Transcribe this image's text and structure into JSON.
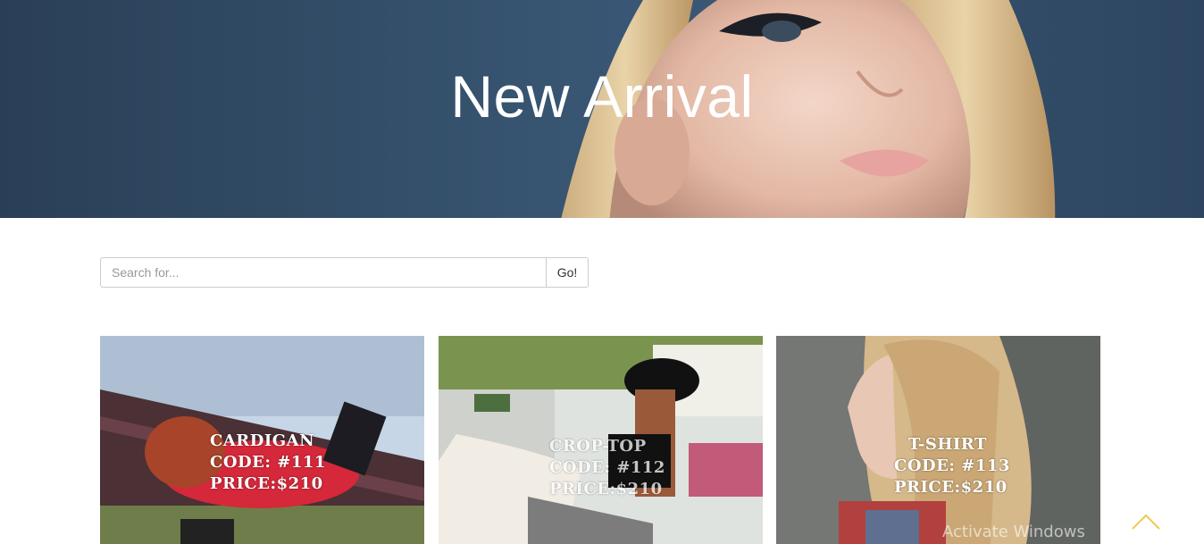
{
  "hero": {
    "title": "New Arrival"
  },
  "search": {
    "placeholder": "Search for...",
    "button_label": "Go!"
  },
  "products": [
    {
      "name": "CARDIGAN",
      "code": "CODE: #111",
      "price": "PRICE:$210"
    },
    {
      "name": "CROP-TOP",
      "code": "CODE: #112",
      "price": "PRICE:$210"
    },
    {
      "name": "T-SHIRT",
      "code": "CODE: #113",
      "price": "PRICE:$210"
    }
  ],
  "overlay": {
    "watermark": "Activate Windows",
    "back_to_top_icon": "chevron-up-icon"
  },
  "colors": {
    "hero_bg": "#34506b",
    "accent": "#f2c94c"
  }
}
